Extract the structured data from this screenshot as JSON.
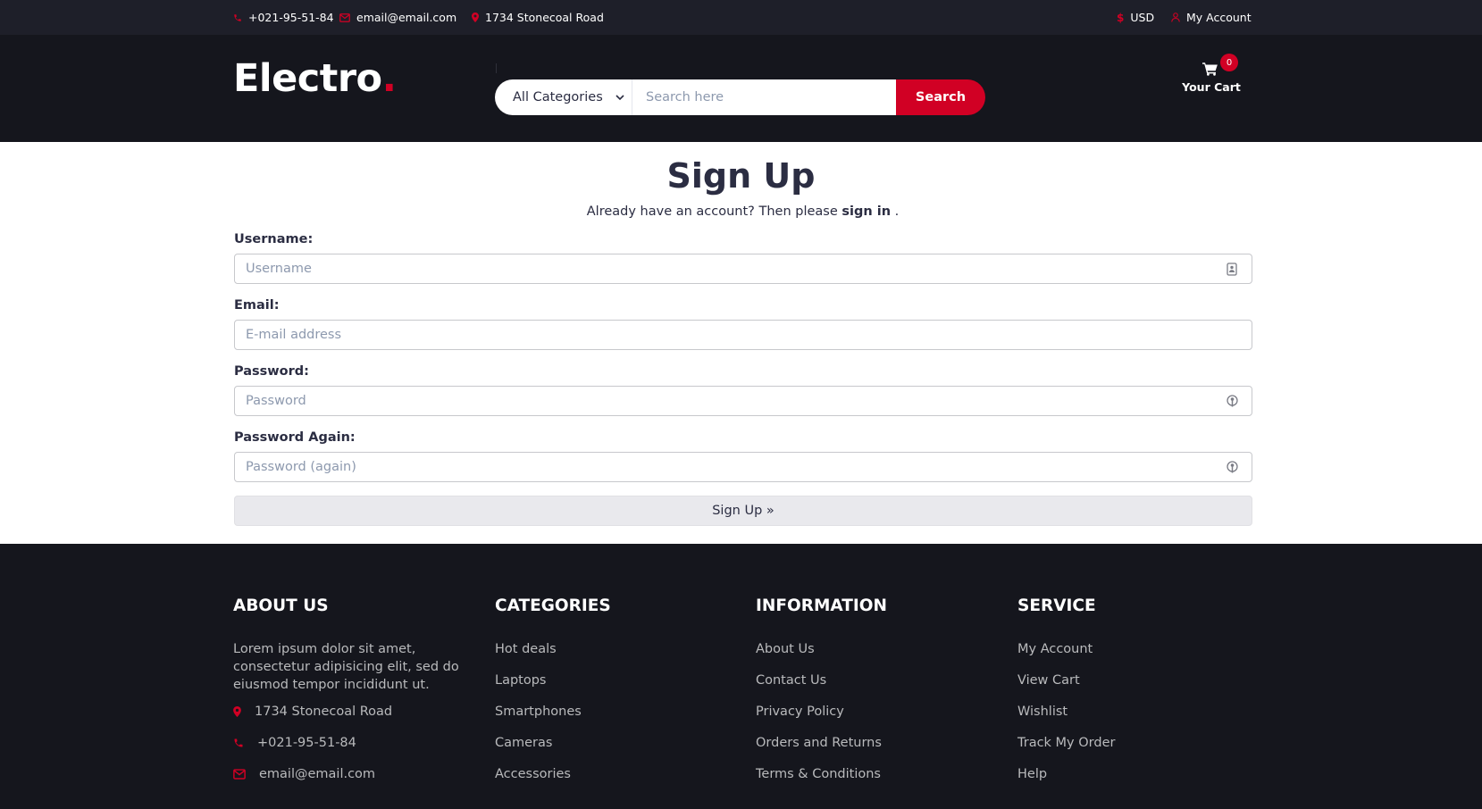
{
  "topbar": {
    "phone": "+021-95-51-84",
    "email": "email@email.com",
    "address": "1734 Stonecoal Road",
    "currency": "USD",
    "account": "My Account"
  },
  "header": {
    "logo_text": "Electro",
    "logo_dot": ".",
    "category_select": "All Categories",
    "search_placeholder": "Search here",
    "search_button": "Search",
    "cart_label": "Your Cart",
    "cart_count": "0"
  },
  "main": {
    "title": "Sign Up",
    "signin_prefix": "Already have an account? Then please",
    "signin_link": "sign in",
    "signin_suffix": ".",
    "fields": [
      {
        "label": "Username:",
        "placeholder": "Username",
        "icon": "contact-card-icon"
      },
      {
        "label": "Email:",
        "placeholder": "E-mail address",
        "icon": ""
      },
      {
        "label": "Password:",
        "placeholder": "Password",
        "icon": "key-icon"
      },
      {
        "label": "Password Again:",
        "placeholder": "Password (again)",
        "icon": "key-icon"
      }
    ],
    "submit_button": "Sign Up »"
  },
  "footer": {
    "about": {
      "heading": "ABOUT US",
      "text": "Lorem ipsum dolor sit amet, consectetur adipisicing elit, sed do eiusmod tempor incididunt ut.",
      "address": "1734 Stonecoal Road",
      "phone": "+021-95-51-84",
      "email": "email@email.com"
    },
    "categories": {
      "heading": "CATEGORIES",
      "links": [
        "Hot deals",
        "Laptops",
        "Smartphones",
        "Cameras",
        "Accessories"
      ]
    },
    "information": {
      "heading": "INFORMATION",
      "links": [
        "About Us",
        "Contact Us",
        "Privacy Policy",
        "Orders and Returns",
        "Terms & Conditions"
      ]
    },
    "service": {
      "heading": "SERVICE",
      "links": [
        "My Account",
        "View Cart",
        "Wishlist",
        "Track My Order",
        "Help"
      ]
    }
  },
  "colors": {
    "accent": "#d10024",
    "topbar_bg": "#1e1f29",
    "header_bg": "#15161d",
    "text_dark": "#2b2d42"
  }
}
